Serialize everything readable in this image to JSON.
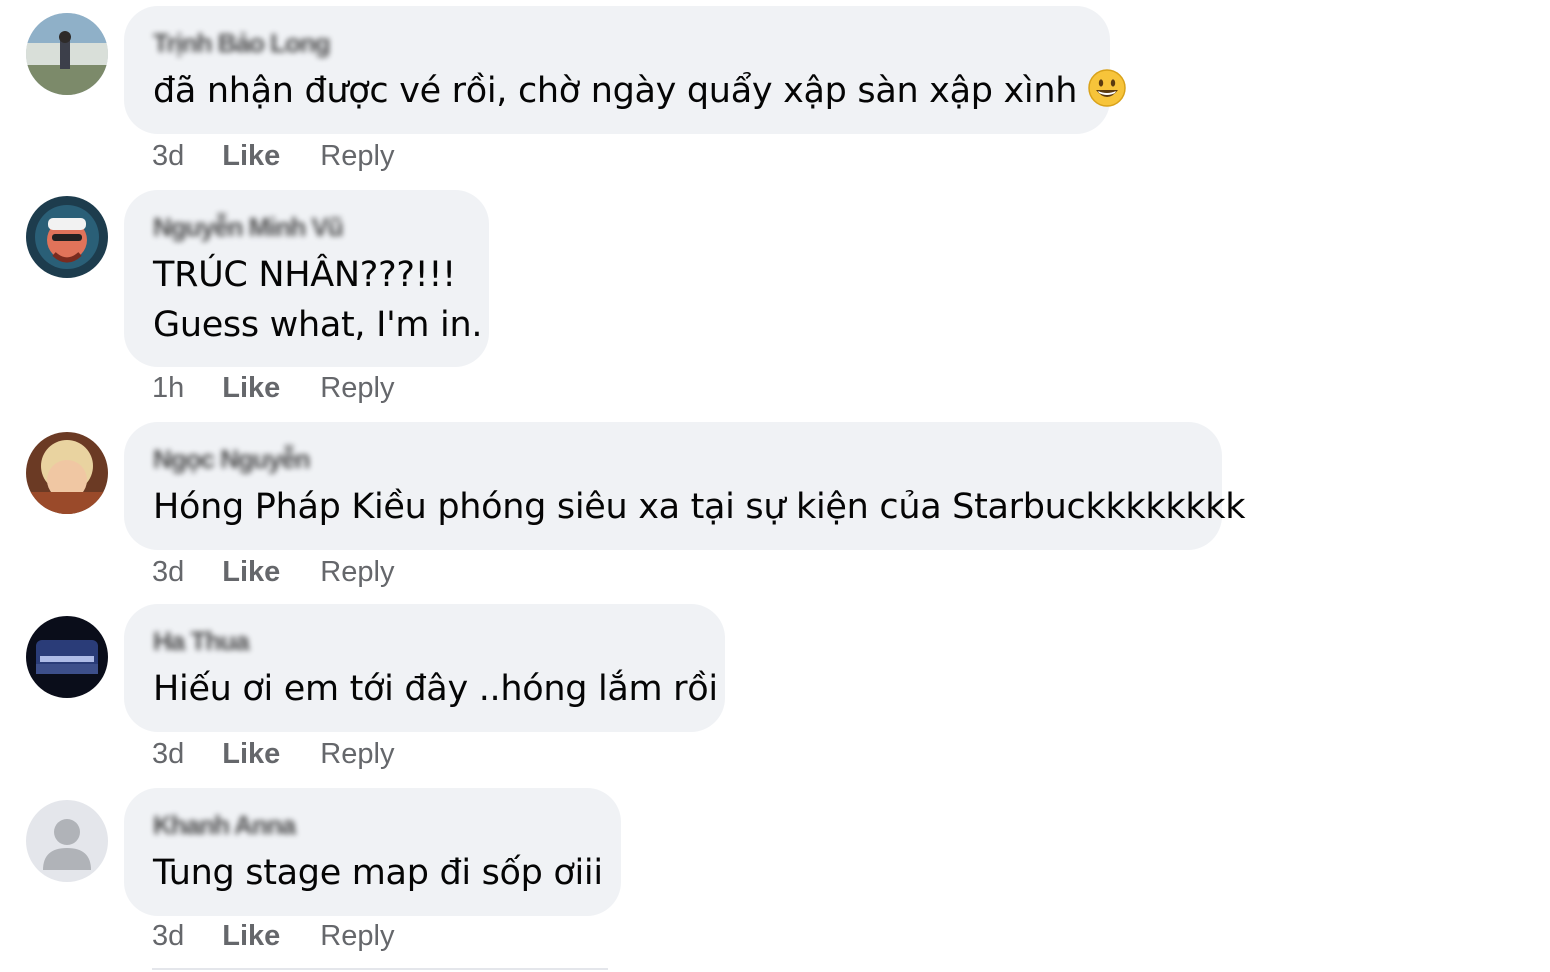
{
  "comments": [
    {
      "author": "Trịnh Bảo Long",
      "lines": [
        "đã nhận được vé rồi, chờ ngày quẩy xập sàn xập xình"
      ],
      "emoji": "grinning-face",
      "time": "3d",
      "like": "Like",
      "reply": "Reply"
    },
    {
      "author": "Nguyễn Minh Vũ",
      "lines": [
        "TRÚC NHÂN???!!!",
        "Guess what, I'm in."
      ],
      "time": "1h",
      "like": "Like",
      "reply": "Reply"
    },
    {
      "author": "Ngọc Nguyễn",
      "lines": [
        "Hóng Pháp Kiều phóng siêu xa tại sự kiện của Starbuckkkkkkkk"
      ],
      "time": "3d",
      "like": "Like",
      "reply": "Reply"
    },
    {
      "author": "Ha Thua",
      "lines": [
        "Hiếu ơi em tới đây ..hóng lắm rồi"
      ],
      "time": "3d",
      "like": "Like",
      "reply": "Reply"
    },
    {
      "author": "Khanh Anna",
      "lines": [
        "Tung stage map đi sốp ơiii"
      ],
      "time": "3d",
      "like": "Like",
      "reply": "Reply"
    }
  ],
  "colors": {
    "bubble": "#f0f2f5",
    "text": "#050505",
    "meta": "#65676b"
  }
}
